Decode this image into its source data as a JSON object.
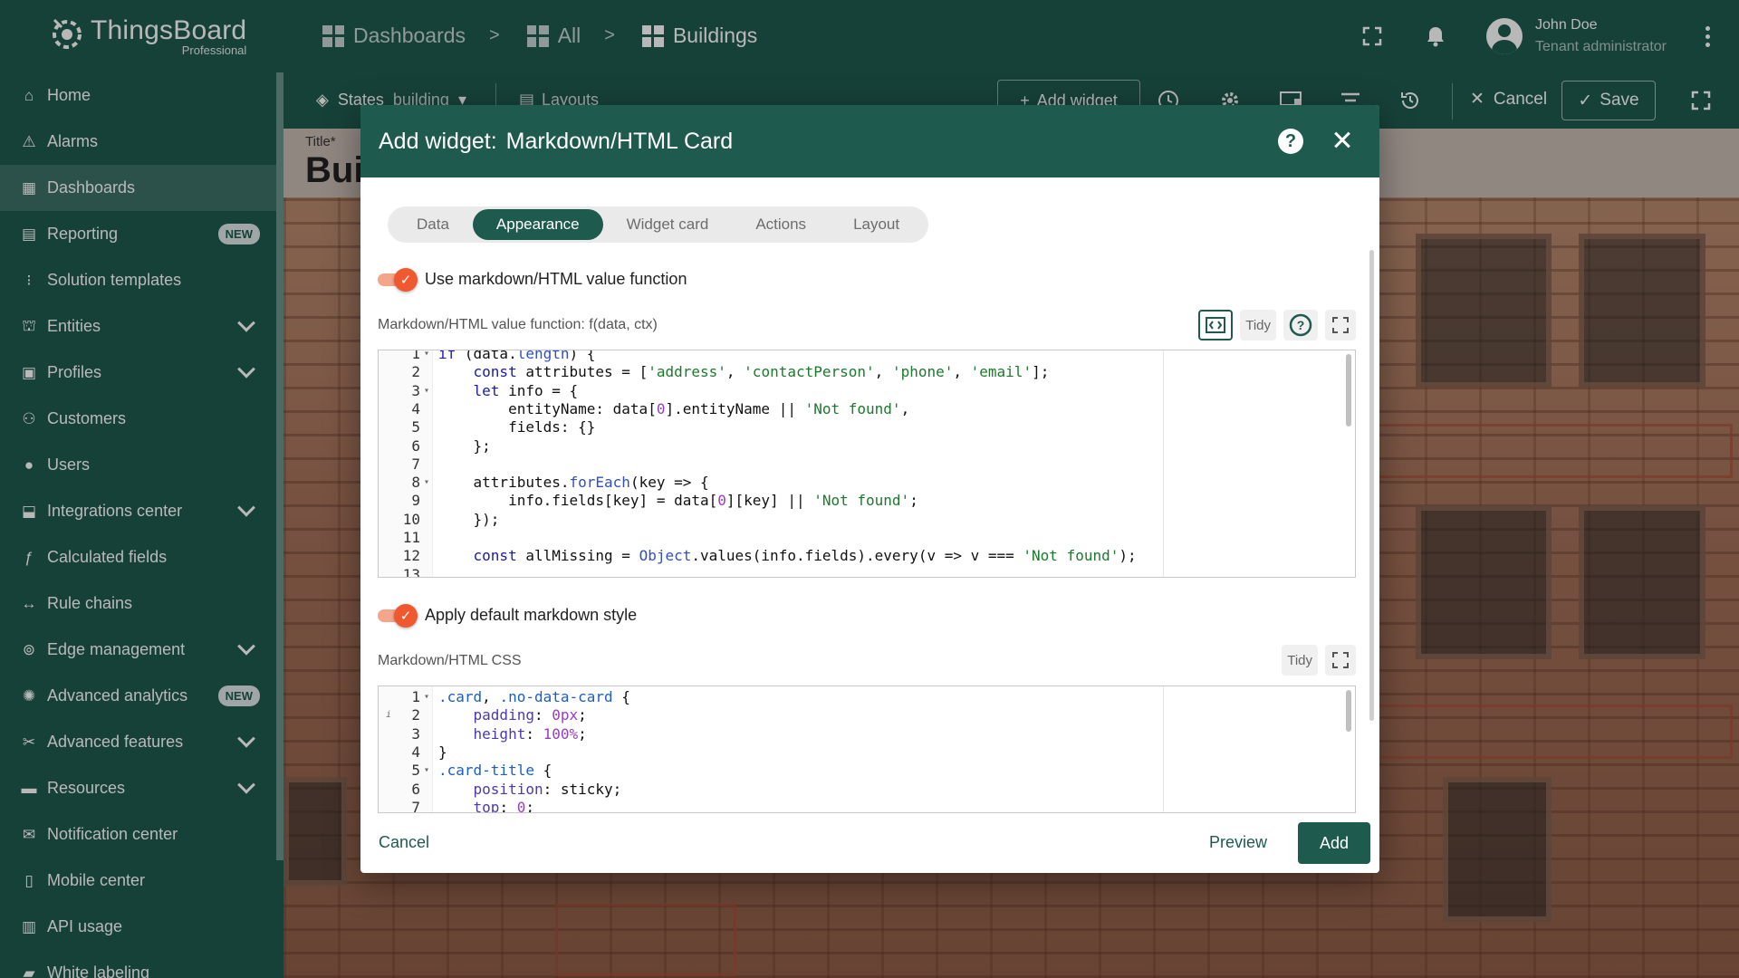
{
  "app": {
    "logo_name": "ThingsBoard",
    "logo_sub": "Professional"
  },
  "breadcrumb": [
    {
      "label": "Dashboards"
    },
    {
      "label": "All"
    },
    {
      "label": "Buildings"
    }
  ],
  "breadcrumb_separator": ">",
  "user": {
    "name": "John Doe",
    "role": "Tenant administrator"
  },
  "sidebar": {
    "items": [
      {
        "label": "Home",
        "icon": "home-icon",
        "glyph": "⌂"
      },
      {
        "label": "Alarms",
        "icon": "alarm-icon",
        "glyph": "⚠"
      },
      {
        "label": "Dashboards",
        "icon": "dashboards-icon",
        "glyph": "▦"
      },
      {
        "label": "Reporting",
        "icon": "reporting-icon",
        "glyph": "▤",
        "badge": "NEW"
      },
      {
        "label": "Solution templates",
        "icon": "solution-templates-icon",
        "glyph": "⁝"
      },
      {
        "label": "Entities",
        "icon": "entities-icon",
        "glyph": "⛫"
      },
      {
        "label": "Profiles",
        "icon": "profiles-icon",
        "glyph": "▣"
      },
      {
        "label": "Customers",
        "icon": "customers-icon",
        "glyph": "⚇"
      },
      {
        "label": "Users",
        "icon": "users-icon",
        "glyph": "●"
      },
      {
        "label": "Integrations center",
        "icon": "integrations-icon",
        "glyph": "⬓"
      },
      {
        "label": "Calculated fields",
        "icon": "calculated-fields-icon",
        "glyph": "ƒ"
      },
      {
        "label": "Rule chains",
        "icon": "rule-chains-icon",
        "glyph": "↔"
      },
      {
        "label": "Edge management",
        "icon": "edge-icon",
        "glyph": "⊚"
      },
      {
        "label": "Advanced analytics",
        "icon": "analytics-icon",
        "glyph": "✺",
        "badge": "NEW"
      },
      {
        "label": "Advanced features",
        "icon": "features-icon",
        "glyph": "✂"
      },
      {
        "label": "Resources",
        "icon": "resources-icon",
        "glyph": "▬"
      },
      {
        "label": "Notification center",
        "icon": "notification-center-icon",
        "glyph": "✉"
      },
      {
        "label": "Mobile center",
        "icon": "mobile-icon",
        "glyph": "▯"
      },
      {
        "label": "API usage",
        "icon": "api-usage-icon",
        "glyph": "▥"
      },
      {
        "label": "White labeling",
        "icon": "white-labeling-icon",
        "glyph": "▰"
      }
    ]
  },
  "toolbar": {
    "states_label": "States",
    "states_value": "building",
    "layouts_label": "Layouts",
    "add_widget_label": "Add widget",
    "cancel_label": "Cancel",
    "save_label": "Save"
  },
  "dashboard": {
    "title_label": "Title*",
    "title": "Bui"
  },
  "dialog": {
    "title_prefix": "Add widget:",
    "title_widget": "Markdown/HTML Card",
    "tabs": [
      {
        "label": "Data"
      },
      {
        "label": "Appearance"
      },
      {
        "label": "Widget card"
      },
      {
        "label": "Actions"
      },
      {
        "label": "Layout"
      }
    ],
    "toggle1_label": "Use markdown/HTML value function",
    "func_label": "Markdown/HTML value function: f(data, ctx)",
    "tidy_label": "Tidy",
    "toggle2_label": "Apply default markdown style",
    "css_label": "Markdown/HTML CSS",
    "cancel_label": "Cancel",
    "preview_label": "Preview",
    "add_label": "Add"
  },
  "code_func": [
    {
      "n": "1",
      "fold": true,
      "text": "if (data.length) {"
    },
    {
      "n": "2",
      "text": "    const attributes = ['address', 'contactPerson', 'phone', 'email'];"
    },
    {
      "n": "3",
      "fold": true,
      "text": "    let info = {"
    },
    {
      "n": "4",
      "text": "        entityName: data[0].entityName || 'Not found',"
    },
    {
      "n": "5",
      "text": "        fields: {}"
    },
    {
      "n": "6",
      "text": "    };"
    },
    {
      "n": "7",
      "text": ""
    },
    {
      "n": "8",
      "fold": true,
      "text": "    attributes.forEach(key => {"
    },
    {
      "n": "9",
      "text": "        info.fields[key] = data[0][key] || 'Not found';"
    },
    {
      "n": "10",
      "text": "    });"
    },
    {
      "n": "11",
      "text": ""
    },
    {
      "n": "12",
      "text": "    const allMissing = Object.values(info.fields).every(v => v === 'Not found');"
    },
    {
      "n": "13",
      "text": ""
    }
  ],
  "code_css": [
    {
      "n": "1",
      "fold": true,
      "text": ".card, .no-data-card {"
    },
    {
      "n": "2",
      "info": true,
      "text": "    padding: 0px;"
    },
    {
      "n": "3",
      "text": "    height: 100%;"
    },
    {
      "n": "4",
      "text": "}"
    },
    {
      "n": "5",
      "fold": true,
      "text": ".card-title {"
    },
    {
      "n": "6",
      "text": "    position: sticky;"
    },
    {
      "n": "7",
      "text": "    top: 0;"
    }
  ],
  "colors": {
    "primary": "#1f5a4f",
    "accent": "#f0592f"
  }
}
